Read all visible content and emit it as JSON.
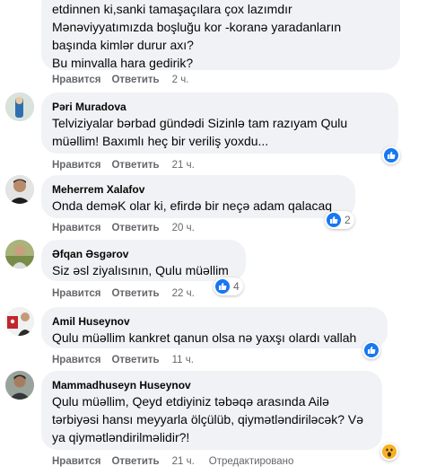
{
  "action_labels": {
    "like": "Нравится",
    "reply": "Ответить",
    "edited": "Отредактировано"
  },
  "comments": [
    {
      "author": "",
      "text": "etdinnen ki,sanki tamaşaçılara çox lazımdır\nMənəviyyatımızda boşluğu kor -koranə yaradanların\nbaşında kimlər durur axı?\nBu minvalla hara gedirik?",
      "time": "2 ч."
    },
    {
      "author": "Pəri Muradova",
      "text": "Telviziyalar bərbad gündədi Sizinlə tam razıyam Qulu\nmüəllim! Baxımlı heç bir veriliş yoxdu...",
      "time": "21 ч.",
      "reaction": {
        "icon": "like-icon",
        "count": ""
      }
    },
    {
      "author": "Meherrem Xalafov",
      "text": "Onda deməK olar ki, efirdə bir neçə adam qalacaq",
      "time": "20 ч.",
      "reaction": {
        "icon": "like-icon",
        "count": "2"
      }
    },
    {
      "author": "Əfqan Əsgərov",
      "text": "Siz əsl ziyalısının, Qulu müəllim",
      "time": "22 ч.",
      "reaction": {
        "icon": "like-icon",
        "count": "4"
      }
    },
    {
      "author": "Amil Huseynov",
      "text": "Qulu müəllim kankret qanun olsa nə yaxşı olardı vallah",
      "time": "11 ч.",
      "reaction": {
        "icon": "like-icon",
        "count": ""
      }
    },
    {
      "author": "Mammadhuseyn Huseynov",
      "text": "Qulu müəllim, Qeyd etdiyiniz təbəqə arasında Ailə\ntərbiyəsi hansı meyyarla ölçülüb, qiymətləndiriləcək? Və\nya qiymətləndirilməlidir?!",
      "time": "21 ч.",
      "edited": true,
      "reaction": {
        "icon": "wow-icon",
        "count": ""
      }
    }
  ],
  "colors": {
    "bubble": "#f0f2f5",
    "like_blue": "#1877f2",
    "wow_yellow": "#f7b125",
    "meta_gray": "#65676b"
  }
}
